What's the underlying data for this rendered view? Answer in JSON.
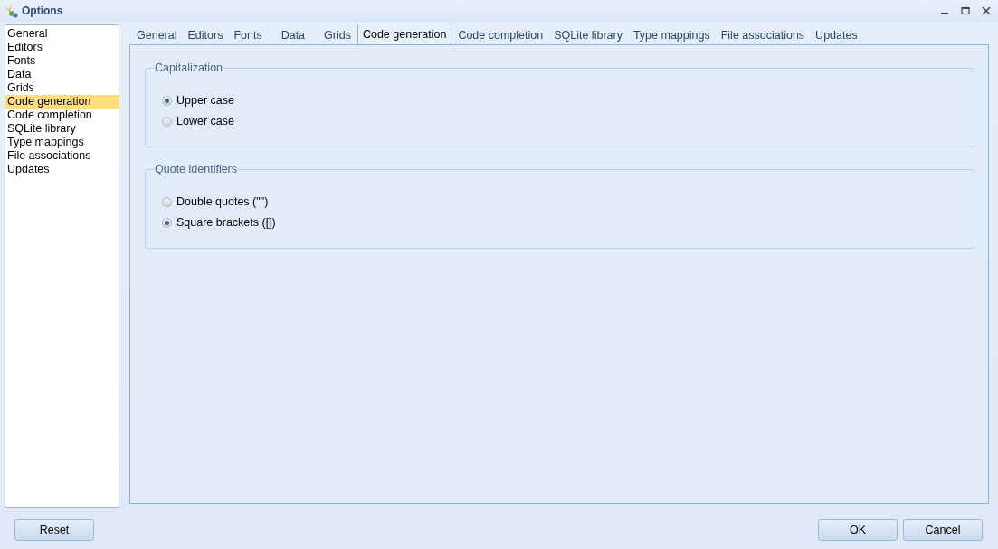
{
  "window": {
    "title": "Options"
  },
  "sidebar": {
    "items": [
      {
        "label": "General",
        "selected": false
      },
      {
        "label": "Editors",
        "selected": false
      },
      {
        "label": "Fonts",
        "selected": false
      },
      {
        "label": "Data",
        "selected": false
      },
      {
        "label": "Grids",
        "selected": false
      },
      {
        "label": "Code generation",
        "selected": true
      },
      {
        "label": "Code completion",
        "selected": false
      },
      {
        "label": "SQLite library",
        "selected": false
      },
      {
        "label": "Type mappings",
        "selected": false
      },
      {
        "label": "File associations",
        "selected": false
      },
      {
        "label": "Updates",
        "selected": false
      }
    ]
  },
  "tabs": [
    {
      "label": "General",
      "selected": false
    },
    {
      "label": "Editors",
      "selected": false
    },
    {
      "label": "Fonts",
      "selected": false
    },
    {
      "label": "Data",
      "selected": false
    },
    {
      "label": "Grids",
      "selected": false
    },
    {
      "label": "Code generation",
      "selected": true
    },
    {
      "label": "Code completion",
      "selected": false
    },
    {
      "label": "SQLite library",
      "selected": false
    },
    {
      "label": "Type mappings",
      "selected": false
    },
    {
      "label": "File associations",
      "selected": false
    },
    {
      "label": "Updates",
      "selected": false
    }
  ],
  "groups": [
    {
      "title": "Capitalization",
      "options": [
        {
          "label": "Upper case",
          "selected": true
        },
        {
          "label": "Lower case",
          "selected": false
        }
      ]
    },
    {
      "title": "Quote identifiers",
      "options": [
        {
          "label": "Double quotes (\"\")",
          "selected": false
        },
        {
          "label": "Square brackets ([])",
          "selected": true
        }
      ]
    }
  ],
  "buttons": {
    "left": [
      "Reset"
    ],
    "right": [
      "OK",
      "Cancel"
    ]
  }
}
